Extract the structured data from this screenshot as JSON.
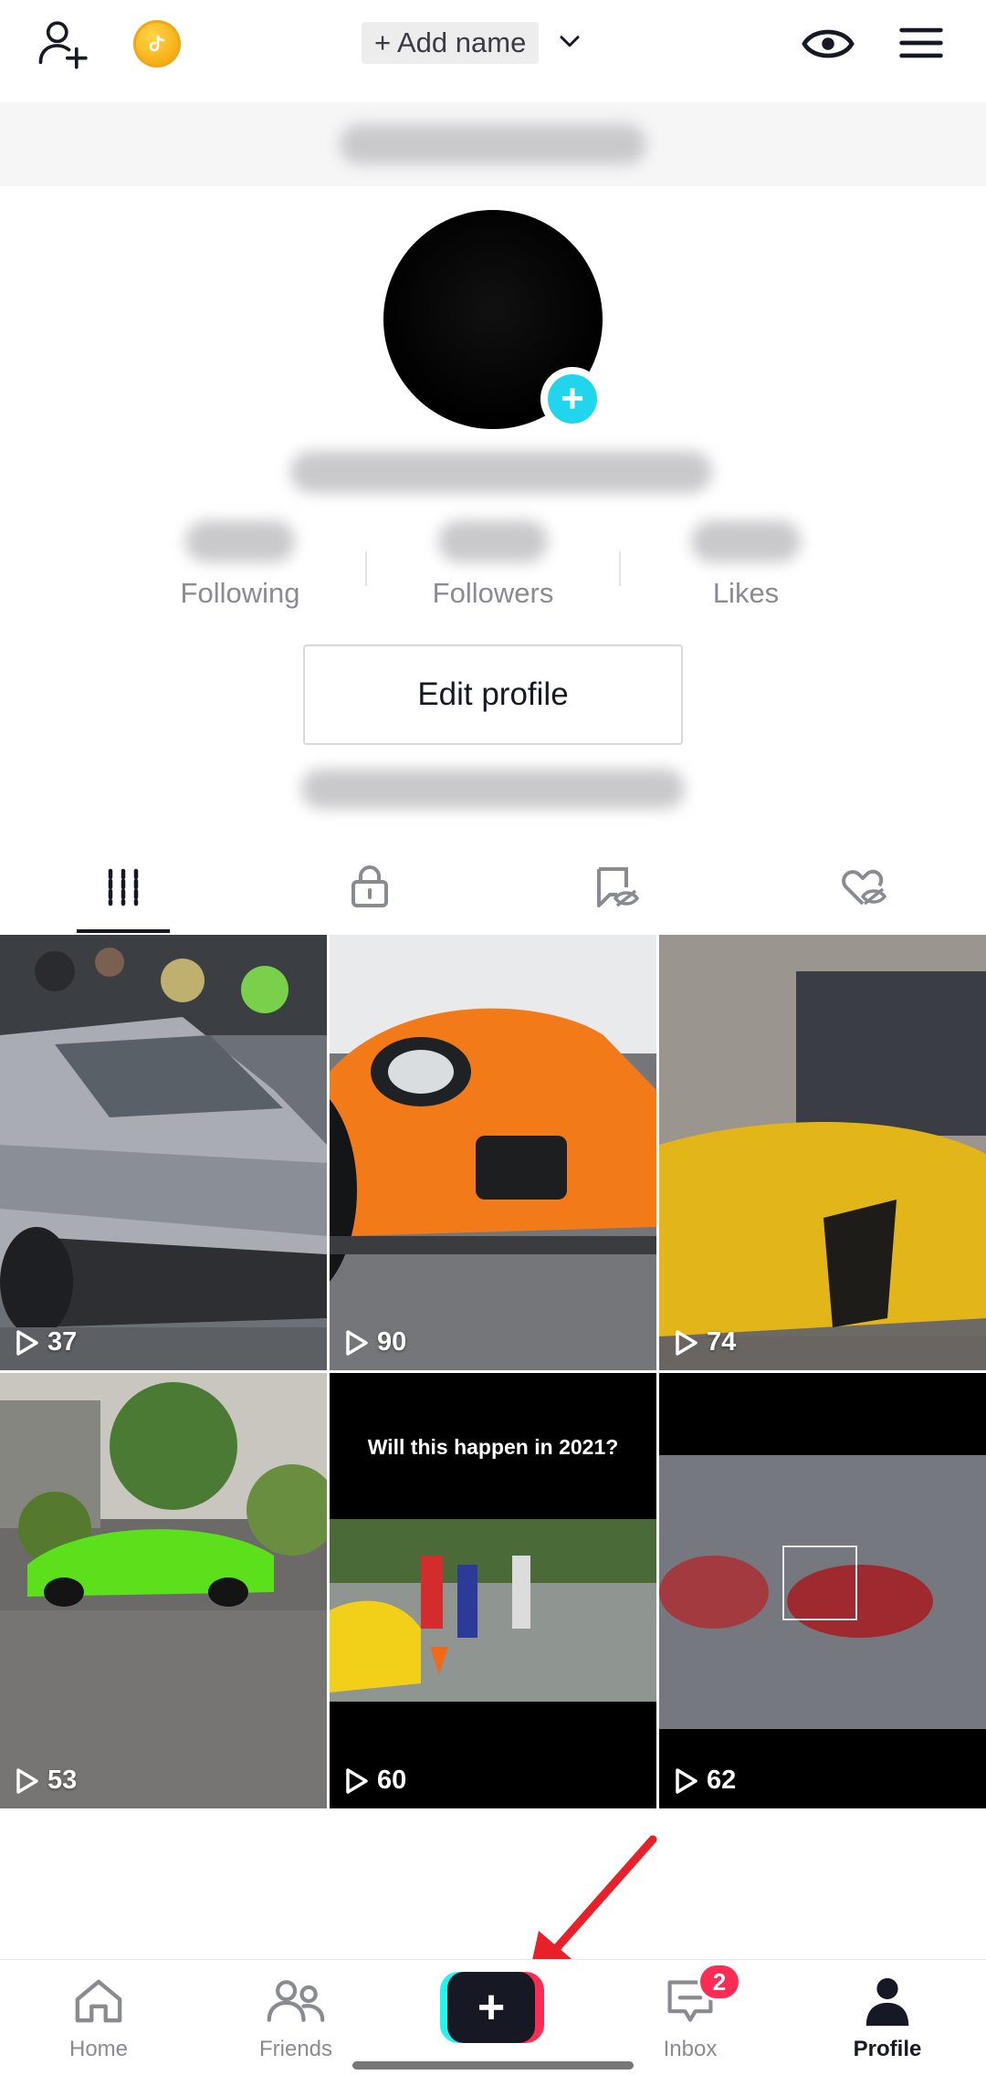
{
  "header": {
    "add_name_label": "+ Add name"
  },
  "stats": [
    {
      "label": "Following"
    },
    {
      "label": "Followers"
    },
    {
      "label": "Likes"
    }
  ],
  "profile": {
    "edit_profile_label": "Edit profile"
  },
  "tabs": [
    {
      "icon": "grid-icon",
      "active": true
    },
    {
      "icon": "lock-icon",
      "active": false
    },
    {
      "icon": "hidden-repost-icon",
      "active": false
    },
    {
      "icon": "hidden-heart-icon",
      "active": false
    }
  ],
  "videos": [
    {
      "views": "37"
    },
    {
      "views": "90"
    },
    {
      "views": "74"
    },
    {
      "views": "53"
    },
    {
      "views": "60",
      "caption": "Will this happen in 2021?"
    },
    {
      "views": "62"
    }
  ],
  "nav": {
    "home": "Home",
    "friends": "Friends",
    "inbox": "Inbox",
    "inbox_badge": "2",
    "profile": "Profile"
  },
  "colors": {
    "accent_cyan": "#20d5ec",
    "accent_pink": "#fe2c55",
    "arrow_red": "#e8202a"
  }
}
